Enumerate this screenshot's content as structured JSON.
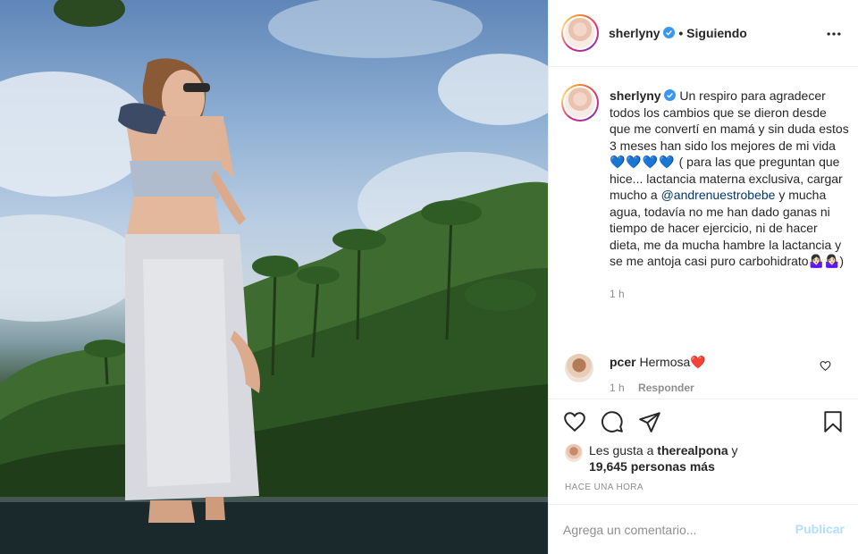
{
  "post": {
    "username": "sherlyny",
    "follow_status": "• Siguiendo",
    "caption_parts": {
      "p1": "Un respiro para agradecer todos los cambios que se dieron desde que me convertí en mamá y sin duda estos 3 meses han sido los mejores de mi vida",
      "hearts": "💙💙💙💙",
      "p2": "( para las que preguntan que hice... lactancia materna exclusiva, cargar mucho a",
      "mention": "@andrenuestrobebe",
      "p3": "y mucha agua, todavía no me han dado ganas ni tiempo de hacer ejercicio, ni de hacer dieta, me da mucha hambre la lactancia y se me antoja casi puro carbohidrato🤷🏻‍♀️🤷🏻‍♀️)"
    },
    "caption_time": "1 h"
  },
  "comment": {
    "username": "pcer",
    "text": "Hermosa❤️",
    "time": "1 h",
    "reply_label": "Responder"
  },
  "likes": {
    "prefix": "Les gusta a",
    "liker": "therealpona",
    "conj": "y",
    "others": "19,645 personas más"
  },
  "timestamp": "Hace una hora",
  "comment_box": {
    "placeholder": "Agrega un comentario...",
    "publish_label": "Publicar"
  },
  "colors": {
    "verified": "#3897f0",
    "mention": "#00376b",
    "publish_disabled": "#b2dffc",
    "like_heart": "#ed4956"
  },
  "icons": [
    "more-icon",
    "verified-icon",
    "heart-icon",
    "comment-icon",
    "share-icon",
    "save-icon",
    "small-heart-icon"
  ]
}
